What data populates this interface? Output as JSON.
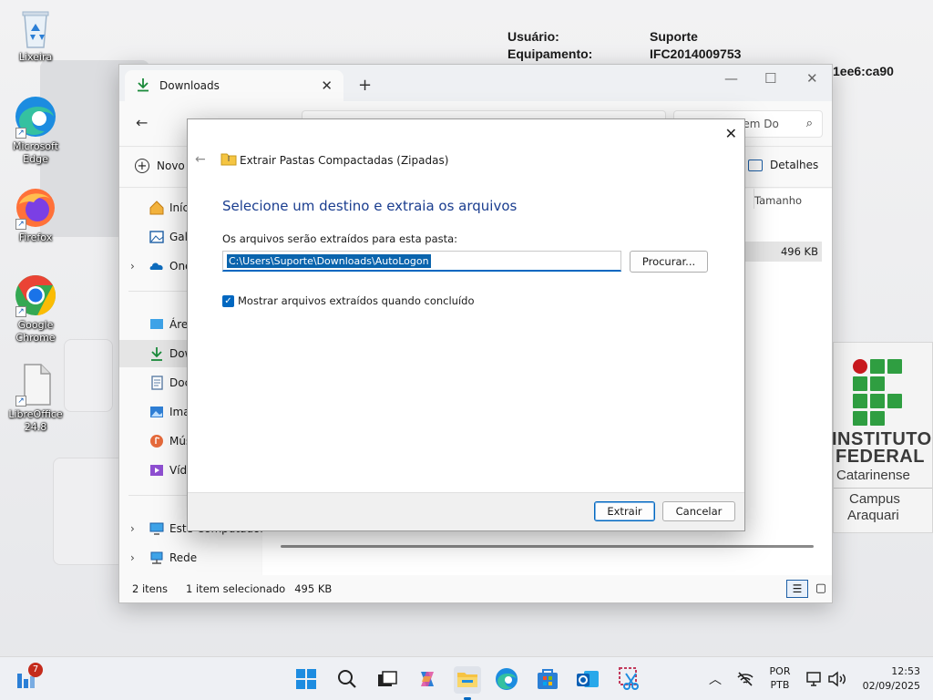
{
  "desktop": {
    "icons": [
      {
        "label": "Lixeira"
      },
      {
        "label": "Microsoft Edge"
      },
      {
        "label": "Firefox"
      },
      {
        "label": "Google Chrome"
      },
      {
        "label": "LibreOffice 24.8"
      }
    ],
    "info": {
      "user_label": "Usuário:",
      "user_value": "Suporte",
      "equip_label": "Equipamento:",
      "equip_value": "IFC2014009753",
      "partial_address": "1ee6:ca90"
    },
    "logo": {
      "line1": "INSTITUTO",
      "line2": "FEDERAL",
      "line3": "Catarinense",
      "campus1": "Campus",
      "campus2": "Araquari"
    }
  },
  "explorer": {
    "tab_label": "Downloads",
    "new_label": "Novo",
    "details_label": "Detalhes",
    "search_partial": "Pesquisar em Do",
    "column_size": "Tamanho",
    "row_size": "496 KB",
    "nav": [
      {
        "label": "Início"
      },
      {
        "label": "Galeria"
      },
      {
        "label": "OneDrive"
      },
      {
        "label": "Área de Trabalho"
      },
      {
        "label": "Downloads"
      },
      {
        "label": "Documentos"
      },
      {
        "label": "Imagens"
      },
      {
        "label": "Músicas"
      },
      {
        "label": "Vídeos"
      },
      {
        "label": "Este Computador"
      },
      {
        "label": "Rede"
      }
    ],
    "status": {
      "count": "2 itens",
      "selected": "1 item selecionado",
      "size": "495 KB"
    }
  },
  "dialog": {
    "title": "Extrair Pastas Compactadas (Zipadas)",
    "heading": "Selecione um destino e extraia os arquivos",
    "path_label": "Os arquivos serão extraídos para esta pasta:",
    "path_value": "C:\\Users\\Suporte\\Downloads\\AutoLogon",
    "browse_label": "Procurar...",
    "checkbox_label": "Mostrar arquivos extraídos quando concluído",
    "checkbox_checked": true,
    "extract_label": "Extrair",
    "cancel_label": "Cancelar"
  },
  "taskbar": {
    "notification_count": "7",
    "lang_top": "POR",
    "lang_bottom": "PTB",
    "time": "12:53",
    "date": "02/09/2025"
  },
  "colors": {
    "accent": "#0067c0",
    "dialog_heading": "#1a3d8f",
    "selection": "#0a64ad",
    "if_green": "#2f9e41",
    "if_red": "#c8191e"
  }
}
